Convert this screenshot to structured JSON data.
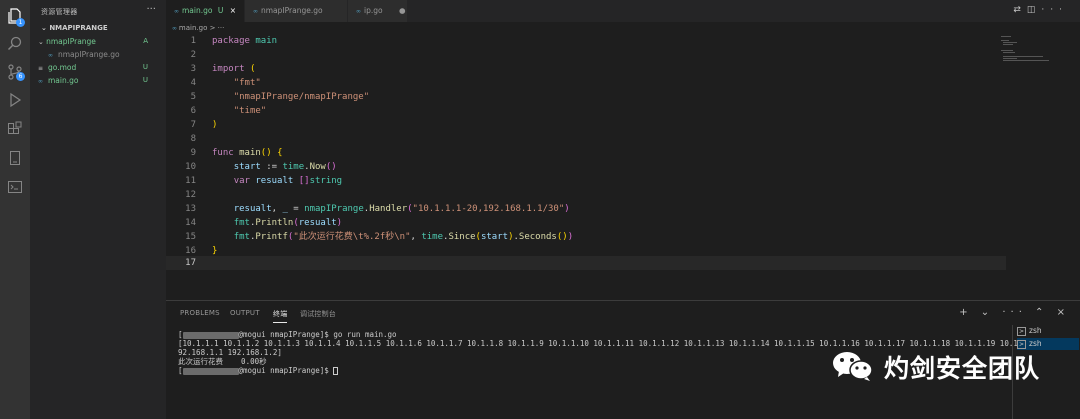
{
  "activity_bar": {
    "icons": [
      "explorer-icon",
      "search-icon",
      "source-control-icon",
      "run-debug-icon",
      "extensions-icon",
      "remote-explorer-icon",
      "terminal-icon"
    ],
    "explorer_badge": "1",
    "scm_badge": "6"
  },
  "sidebar": {
    "title": "资源管理器",
    "more": "···",
    "section": "NMAPIPRANGE",
    "items": [
      {
        "label": "nmapIPrange",
        "status": "A",
        "color": "#73c991"
      },
      {
        "label": "nmapIPrange.go",
        "status": "",
        "color": "#8c8c8c"
      },
      {
        "label": "go.mod",
        "status": "U",
        "color": "#73c991"
      },
      {
        "label": "main.go",
        "status": "U",
        "color": "#73c991"
      }
    ]
  },
  "tabs": [
    {
      "label": "main.go",
      "status": "U",
      "close": "×"
    },
    {
      "label": "nmapIPrange.go",
      "status": "",
      "close": ""
    },
    {
      "label": "ip.go",
      "status": "",
      "close": "●"
    }
  ],
  "breadcrumb": "main.go  >  ···",
  "editor": {
    "line_numbers": [
      "1",
      "2",
      "3",
      "4",
      "5",
      "6",
      "7",
      "8",
      "9",
      "10",
      "11",
      "12",
      "13",
      "14",
      "15",
      "16",
      "17"
    ],
    "current_line": "17"
  },
  "panel": {
    "tabs": [
      "PROBLEMS",
      "OUTPUT",
      "终端",
      "调试控制台"
    ],
    "active_tab": "终端",
    "actions": "+ ⌄ ···  ⌃ ×",
    "terminal": {
      "prompt_suffix_1": "@mogui nmapIPrange]$ go run main.go",
      "output_1": "[10.1.1.1 10.1.1.2 10.1.1.3 10.1.1.4 10.1.1.5 10.1.1.6 10.1.1.7 10.1.1.8 10.1.1.9 10.1.1.10 10.1.1.11 10.1.1.12 10.1.1.13 10.1.1.14 10.1.1.15 10.1.1.16 10.1.1.17 10.1.1.18 10.1.1.19 10.1.1.20 1",
      "output_2": "92.168.1.1 192.168.1.2]",
      "output_3": "此次运行花费    0.00秒",
      "prompt_suffix_2": "@mogui nmapIPrange]$ "
    },
    "shells": [
      "zsh",
      "zsh"
    ]
  },
  "watermark": {
    "text": "灼剑安全团队"
  },
  "colors": {
    "background": "#1e1e1e",
    "sidebar": "#252526",
    "activity_bar": "#333333",
    "keyword": "#c586c0",
    "string": "#ce9178",
    "function": "#dcdcaa"
  }
}
